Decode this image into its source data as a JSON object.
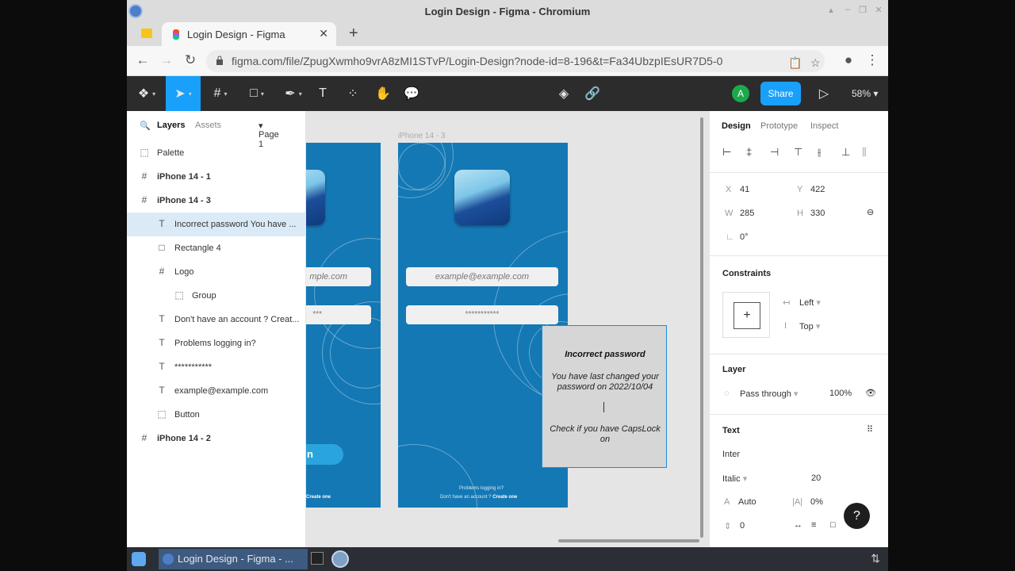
{
  "window": {
    "title": "Login Design - Figma - Chromium",
    "tab_title": "Login Design - Figma",
    "url": "figma.com/file/ZpugXwmho9vrA8zMI1STvP/Login-Design?node-id=8-196&t=Fa34UbzpIEsUR7D5-0"
  },
  "toolbar": {
    "share_label": "Share",
    "avatar_letter": "A",
    "zoom": "58%"
  },
  "layers_panel": {
    "tabs": [
      "Layers",
      "Assets"
    ],
    "page": "Page 1",
    "items": [
      {
        "label": "Palette",
        "icon": "dotted-frame-icon",
        "indent": 0,
        "bold": false
      },
      {
        "label": "iPhone 14 - 1",
        "icon": "frame-icon",
        "indent": 0,
        "bold": true
      },
      {
        "label": "iPhone 14 - 3",
        "icon": "frame-icon",
        "indent": 0,
        "bold": true
      },
      {
        "label": "Incorrect password You have ...",
        "icon": "text-icon",
        "indent": 1,
        "bold": false,
        "selected": true
      },
      {
        "label": "Rectangle 4",
        "icon": "rectangle-icon",
        "indent": 1,
        "bold": false
      },
      {
        "label": "Logo",
        "icon": "frame-icon",
        "indent": 1,
        "bold": false
      },
      {
        "label": "Group",
        "icon": "dotted-frame-icon",
        "indent": 2,
        "bold": false
      },
      {
        "label": "Don't have an account ? Creat...",
        "icon": "text-icon",
        "indent": 1,
        "bold": false
      },
      {
        "label": "Problems logging in?",
        "icon": "text-icon",
        "indent": 1,
        "bold": false
      },
      {
        "label": "***********",
        "icon": "text-icon",
        "indent": 1,
        "bold": false
      },
      {
        "label": "example@example.com",
        "icon": "text-icon",
        "indent": 1,
        "bold": false
      },
      {
        "label": "Button",
        "icon": "dotted-frame-icon",
        "indent": 1,
        "bold": false
      },
      {
        "label": "iPhone 14 - 2",
        "icon": "frame-icon",
        "indent": 0,
        "bold": true
      }
    ]
  },
  "canvas": {
    "frame_label": "iPhone 14 - 3",
    "email_placeholder": "example@example.com",
    "email_partial": "mple.com",
    "password_mask": "***********",
    "password_partial": "***",
    "popup_heading": "Incorrect password",
    "popup_line1": "You have last changed your password on 2022/10/04",
    "popup_line2": "Check if you have CapsLock on",
    "signin_partial": "n",
    "problems_text": "Problems logging in?",
    "no_account_text": "Don't have an account ?",
    "create_one": "Create one"
  },
  "design_panel": {
    "tabs": [
      "Design",
      "Prototype",
      "Inspect"
    ],
    "x_label": "X",
    "x": "41",
    "y_label": "Y",
    "y": "422",
    "w_label": "W",
    "w": "285",
    "h_label": "H",
    "h": "330",
    "rotation": "0°",
    "constraints_title": "Constraints",
    "constraint_h": "Left",
    "constraint_v": "Top",
    "layer_title": "Layer",
    "blend": "Pass through",
    "opacity": "100%",
    "text_title": "Text",
    "font": "Inter",
    "style": "Italic",
    "size": "20",
    "line_height": "Auto",
    "letter_spacing": "0%",
    "paragraph_spacing": "0"
  },
  "taskbar": {
    "task_label": "Login Design - Figma - ..."
  },
  "colors": {
    "figma_blue": "#18a0fb",
    "frame_blue": "#1478b4",
    "toolbar_dark": "#2c2c2c",
    "selection": "#daebf7"
  }
}
